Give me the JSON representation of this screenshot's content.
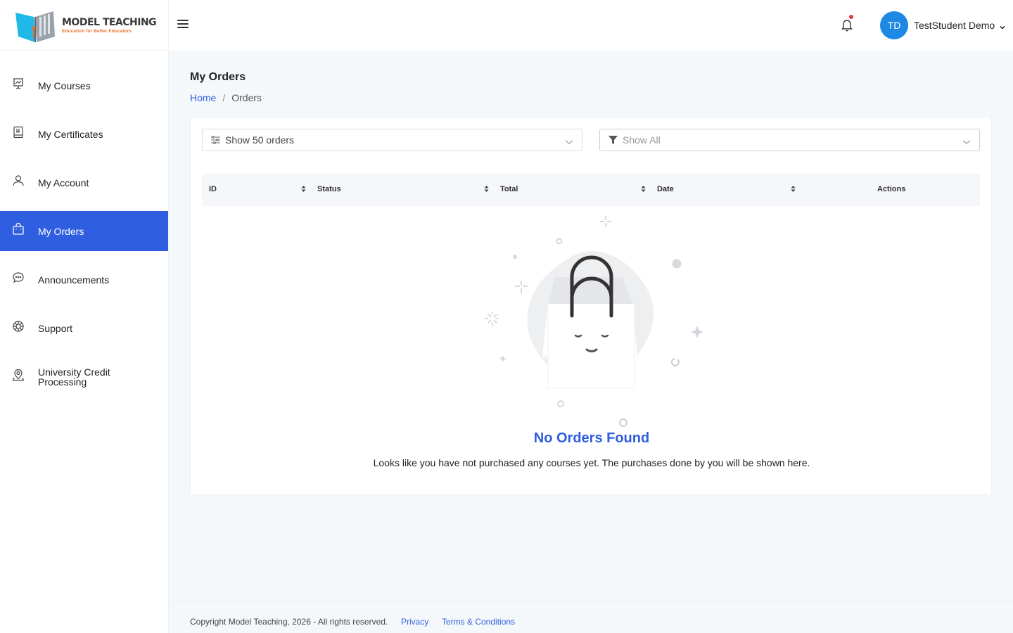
{
  "brand": {
    "title": "MODEL TEACHING",
    "tagline": "Education for Better Educators",
    "colors": {
      "primary": "#2f5fe0",
      "logo_cyan": "#1fb8e8",
      "logo_orange": "#e8712a"
    }
  },
  "sidebar": {
    "items": [
      {
        "label": "My Courses",
        "icon": "presentation-chart-icon"
      },
      {
        "label": "My Certificates",
        "icon": "certificate-book-icon"
      },
      {
        "label": "My Account",
        "icon": "user-icon"
      },
      {
        "label": "My Orders",
        "icon": "shopping-bag-icon",
        "active": true
      },
      {
        "label": "Announcements",
        "icon": "chat-bubble-icon"
      },
      {
        "label": "Support",
        "icon": "lifebuoy-icon"
      },
      {
        "label": "University Credit Processing",
        "icon": "location-badge-icon"
      }
    ]
  },
  "header": {
    "user_initials": "TD",
    "user_name": "TestStudent Demo"
  },
  "page": {
    "title": "My Orders",
    "breadcrumb": {
      "home": "Home",
      "separator": "/",
      "current": "Orders"
    }
  },
  "filters": {
    "page_size": "Show 50 orders",
    "status_filter": "Show All"
  },
  "table": {
    "columns": [
      "ID",
      "Status",
      "Total",
      "Date",
      "Actions"
    ]
  },
  "empty_state": {
    "title": "No Orders Found",
    "message": "Looks like you have not purchased any courses yet. The purchases done by you will be shown here."
  },
  "footer": {
    "copyright": "Copyright Model Teaching, 2026 - All rights reserved.",
    "privacy": "Privacy",
    "terms": "Terms & Conditions"
  }
}
